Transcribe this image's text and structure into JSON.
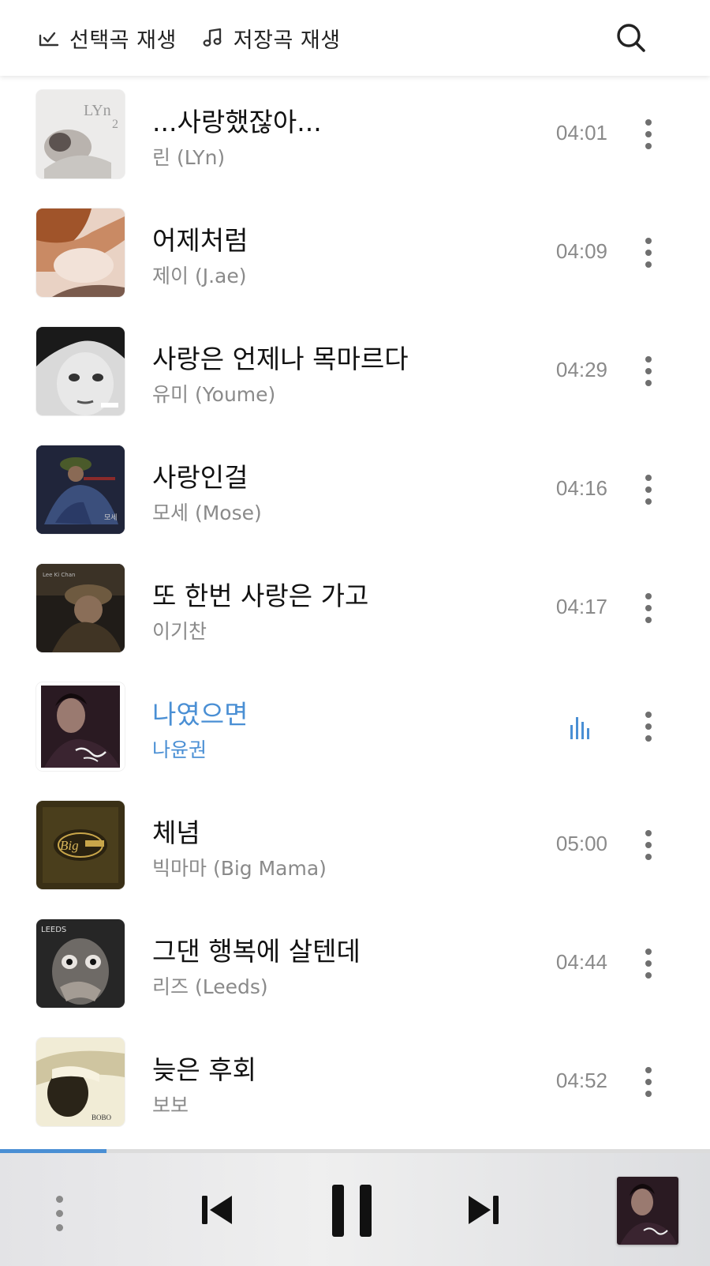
{
  "header": {
    "play_selected_label": "선택곡 재생",
    "play_saved_label": "저장곡 재생"
  },
  "tracks": [
    {
      "title": "...사랑했잖아...",
      "artist": "린 (LYn)",
      "duration": "04:01",
      "playing": false
    },
    {
      "title": "어제처럼",
      "artist": "제이 (J.ae)",
      "duration": "04:09",
      "playing": false
    },
    {
      "title": "사랑은 언제나 목마르다",
      "artist": "유미 (Youme)",
      "duration": "04:29",
      "playing": false
    },
    {
      "title": "사랑인걸",
      "artist": "모세 (Mose)",
      "duration": "04:16",
      "playing": false
    },
    {
      "title": "또 한번 사랑은 가고",
      "artist": "이기찬",
      "duration": "04:17",
      "playing": false
    },
    {
      "title": "나였으면",
      "artist": "나윤권",
      "duration": "",
      "playing": true
    },
    {
      "title": "체념",
      "artist": "빅마마 (Big Mama)",
      "duration": "05:00",
      "playing": false
    },
    {
      "title": "그댄 행복에 살텐데",
      "artist": "리즈 (Leeds)",
      "duration": "04:44",
      "playing": false
    },
    {
      "title": "늦은 후회",
      "artist": "보보",
      "duration": "04:52",
      "playing": false
    }
  ],
  "player": {
    "progress": 0.15,
    "state": "playing"
  },
  "colors": {
    "accent": "#4a8fd4",
    "secondary_text": "#8a8a8a"
  }
}
